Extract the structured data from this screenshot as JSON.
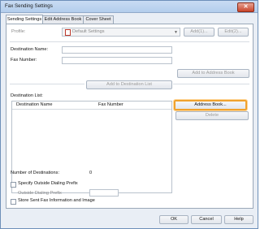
{
  "window": {
    "title": "Fax Sending Settings",
    "close_glyph": "✕"
  },
  "tabs": [
    {
      "label": "Sending Settings",
      "active": true
    },
    {
      "label": "Edit Address Book",
      "active": false
    },
    {
      "label": "Cover Sheet",
      "active": false
    }
  ],
  "profile": {
    "label": "Profile:",
    "value": "Default Settings",
    "add_label": "Add(1)...",
    "edit_label": "Edit(2)..."
  },
  "destination_name": {
    "label": "Destination Name:",
    "value": ""
  },
  "fax_number": {
    "label": "Fax Number:",
    "value": ""
  },
  "buttons": {
    "add_to_address_book": "Add to Address Book",
    "add_to_destination_list": "Add to Destination List",
    "address_book": "Address Book...",
    "delete": "Delete",
    "ok": "OK",
    "cancel": "Cancel",
    "help": "Help"
  },
  "destination_list": {
    "label": "Destination List:",
    "columns": [
      "Destination Name",
      "Fax Number"
    ],
    "rows": []
  },
  "number_of_destinations": {
    "label": "Number of Destinations:",
    "value": "0"
  },
  "outside_dialing": {
    "checkbox_label": "Specify Outside Dialing Prefix",
    "prefix_label": "Outside Dialing Prefix",
    "prefix_value": "",
    "checked": false
  },
  "store_sent": {
    "checkbox_label": "Store Sent Fax Information and Image",
    "checked": false
  },
  "colors": {
    "accent_focus": "#f0a22e",
    "close_red": "#c9442a",
    "title_bar": "#c9dcf3"
  },
  "icons": {
    "close": "close-icon",
    "profile": "document-icon",
    "dropdown": "chevron-down-icon"
  }
}
